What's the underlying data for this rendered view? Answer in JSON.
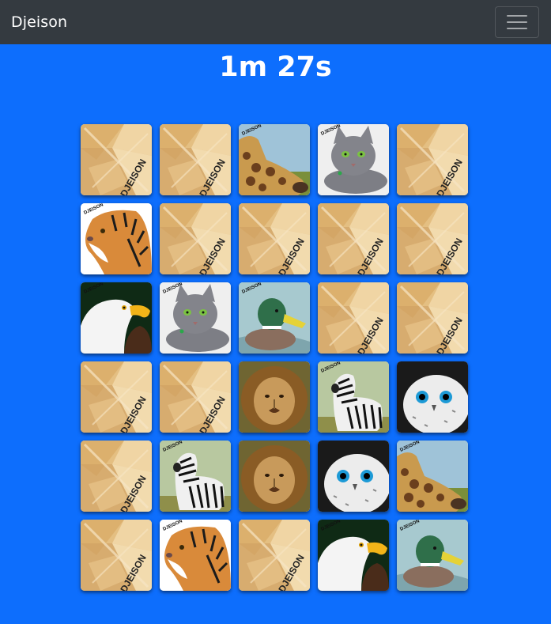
{
  "navbar": {
    "brand": "Djeison",
    "toggler_icon": "hamburger-icon"
  },
  "game": {
    "timer": "1m 27s",
    "card_back_text": "DJEISON",
    "card_corner_text": "DJEISON",
    "grid_columns": 5,
    "cards": [
      {
        "state": "hidden"
      },
      {
        "state": "hidden"
      },
      {
        "state": "revealed",
        "animal": "giraffe"
      },
      {
        "state": "revealed",
        "animal": "cat"
      },
      {
        "state": "hidden"
      },
      {
        "state": "revealed",
        "animal": "tiger"
      },
      {
        "state": "hidden"
      },
      {
        "state": "hidden"
      },
      {
        "state": "hidden"
      },
      {
        "state": "hidden"
      },
      {
        "state": "revealed",
        "animal": "eagle"
      },
      {
        "state": "revealed",
        "animal": "cat"
      },
      {
        "state": "revealed",
        "animal": "duck"
      },
      {
        "state": "hidden"
      },
      {
        "state": "hidden"
      },
      {
        "state": "hidden"
      },
      {
        "state": "hidden"
      },
      {
        "state": "revealed",
        "animal": "lion"
      },
      {
        "state": "revealed",
        "animal": "zebra"
      },
      {
        "state": "revealed",
        "animal": "owl"
      },
      {
        "state": "hidden"
      },
      {
        "state": "revealed",
        "animal": "zebra"
      },
      {
        "state": "revealed",
        "animal": "lion"
      },
      {
        "state": "revealed",
        "animal": "owl"
      },
      {
        "state": "revealed",
        "animal": "giraffe"
      },
      {
        "state": "hidden"
      },
      {
        "state": "revealed",
        "animal": "tiger"
      },
      {
        "state": "hidden"
      },
      {
        "state": "revealed",
        "animal": "eagle"
      },
      {
        "state": "revealed",
        "animal": "duck"
      }
    ]
  },
  "colors": {
    "background": "#0d6efd",
    "navbar": "#343a40",
    "card_back": "#e9c98e"
  }
}
